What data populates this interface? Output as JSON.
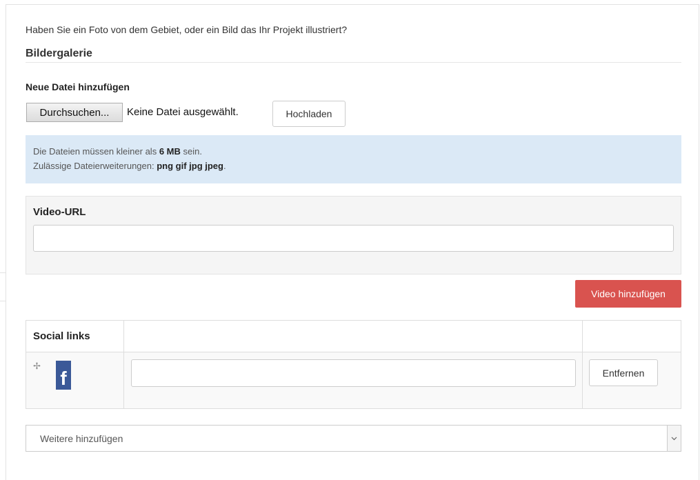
{
  "intro_text": "Haben Sie ein Foto von dem Gebiet, oder ein Bild das Ihr Projekt illustriert?",
  "gallery": {
    "title": "Bildergalerie",
    "new_file_label": "Neue Datei hinzufügen",
    "browse_label": "Durchsuchen...",
    "no_file_text": "Keine Datei ausgewählt.",
    "upload_label": "Hochladen"
  },
  "info": {
    "line1_prefix": "Die Dateien müssen kleiner als ",
    "line1_size": "6 MB",
    "line1_suffix": " sein.",
    "line2_prefix": "Zulässige Dateierweiterungen: ",
    "line2_extensions": "png gif jpg jpeg",
    "line2_suffix": "."
  },
  "video": {
    "label": "Video-URL",
    "value": "",
    "add_label": "Video hinzufügen"
  },
  "social": {
    "header_label": "Social links",
    "rows": [
      {
        "icon": "facebook-icon",
        "value": "",
        "remove_label": "Entfernen"
      }
    ]
  },
  "more_select": {
    "selected": "Weitere hinzufügen"
  },
  "colors": {
    "info_bg": "#dbe9f6",
    "danger": "#d9534f",
    "facebook": "#3b5998"
  }
}
